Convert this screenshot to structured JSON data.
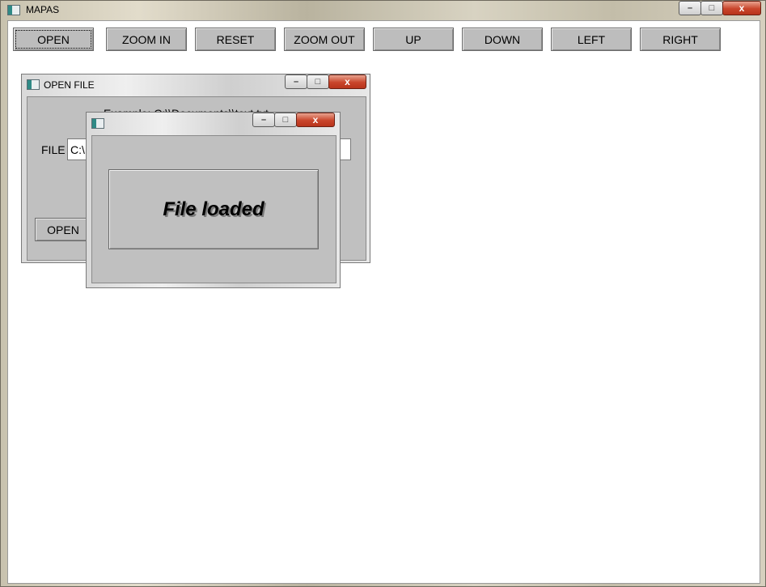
{
  "app": {
    "title": "MAPAS"
  },
  "window_controls": {
    "minimize": "–",
    "maximize": "□",
    "close": "x"
  },
  "toolbar": {
    "buttons": [
      {
        "label": "OPEN"
      },
      {
        "label": "ZOOM IN"
      },
      {
        "label": "RESET"
      },
      {
        "label": "ZOOM OUT"
      },
      {
        "label": "UP"
      },
      {
        "label": "DOWN"
      },
      {
        "label": "LEFT"
      },
      {
        "label": "RIGHT"
      }
    ]
  },
  "open_file_dialog": {
    "title": "OPEN FILE",
    "example_text": "Example: C:\\\\Documents\\\\text.txt",
    "file_label": "FILE",
    "file_value": "C:\\",
    "open_button": "OPEN"
  },
  "message_dialog": {
    "title": "",
    "message": "File loaded"
  },
  "colors": {
    "button_face": "#bdbdbd",
    "dialog_face": "#c0c0c0",
    "close_button": "#c9452b",
    "client_bg": "#ffffff"
  }
}
